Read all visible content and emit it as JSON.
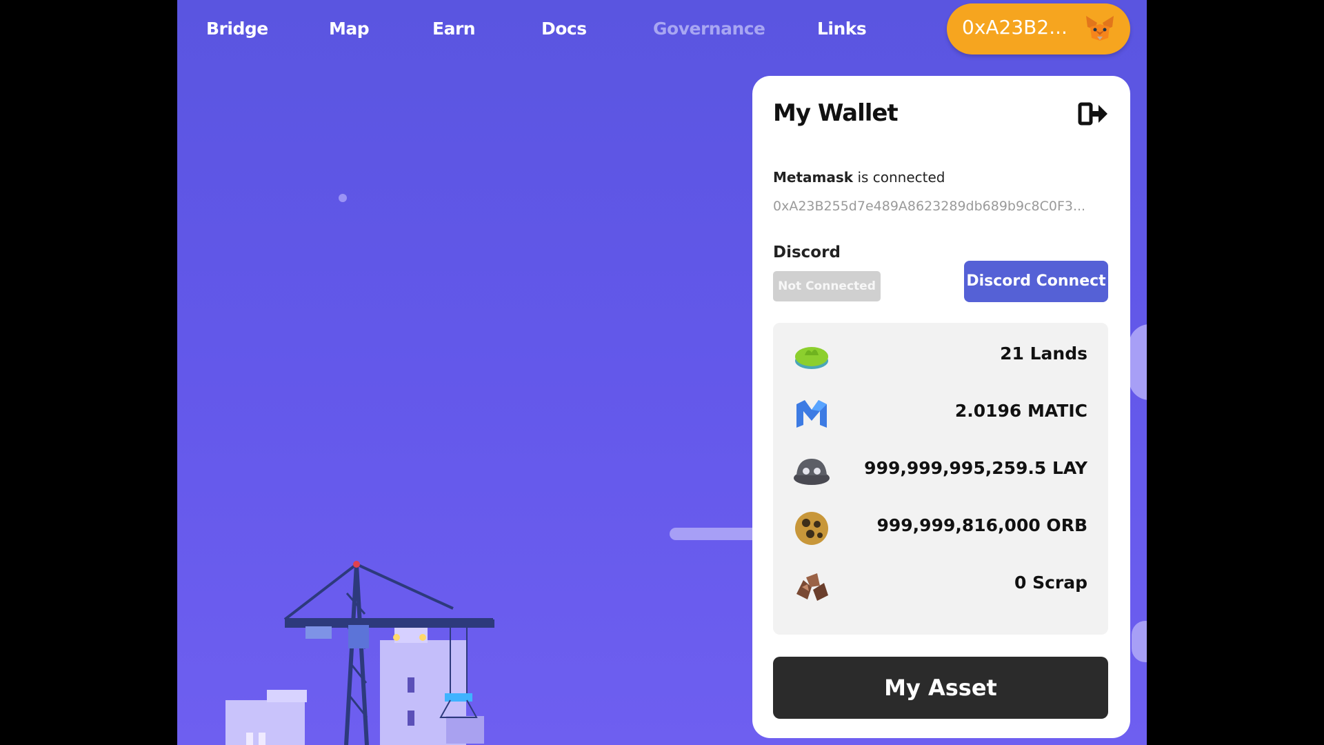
{
  "nav": {
    "items": [
      {
        "label": "Bridge"
      },
      {
        "label": "Map"
      },
      {
        "label": "Earn"
      },
      {
        "label": "Docs"
      },
      {
        "label": "Governance"
      },
      {
        "label": "Links"
      }
    ],
    "wallet_button": {
      "address_short": "0xA23B2...",
      "icon": "metamask-fox-icon"
    }
  },
  "wallet_panel": {
    "title": "My Wallet",
    "provider": "Metamask",
    "connected_text": "is connected",
    "address": "0xA23B255d7e489A8623289db689b9c8C0F3...",
    "discord": {
      "label": "Discord",
      "status": "Not Connected",
      "connect_label": "Discord Connect"
    },
    "assets": [
      {
        "icon": "land-island-icon",
        "value": "21 Lands"
      },
      {
        "icon": "matic-icon",
        "value": "2.0196 MATIC"
      },
      {
        "icon": "lay-token-icon",
        "value": "999,999,995,259.5 LAY"
      },
      {
        "icon": "orb-token-icon",
        "value": "999,999,816,000 ORB"
      },
      {
        "icon": "scrap-icon",
        "value": "0 Scrap"
      }
    ],
    "my_asset_label": "My Asset"
  },
  "colors": {
    "background": "#5f58e6",
    "wallet_button": "#f6a51f",
    "discord_button": "#5561d6",
    "my_asset_button": "#2b2b2b"
  }
}
